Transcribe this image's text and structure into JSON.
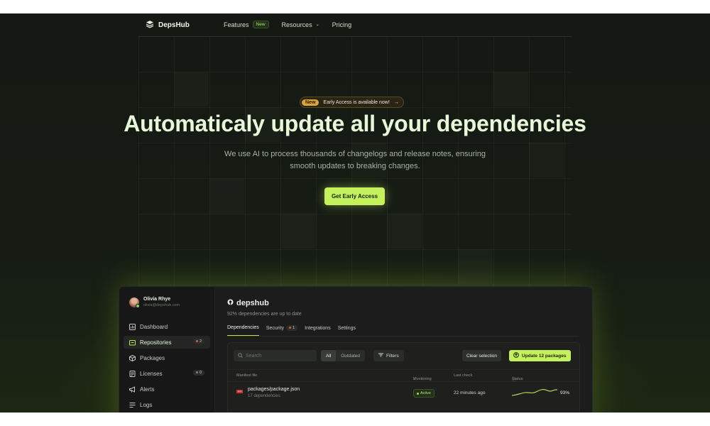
{
  "nav": {
    "brand": "DepsHub",
    "links": [
      {
        "label": "Features",
        "badge": "New"
      },
      {
        "label": "Resources"
      },
      {
        "label": "Pricing"
      }
    ]
  },
  "hero": {
    "eyebrow_tag": "New",
    "eyebrow_text": "Early Access is available now!",
    "title": "Automaticaly update all your dependencies",
    "subtitle_line1": "We use AI to process thousands of changelogs and release notes, ensuring",
    "subtitle_line2": "smooth updates to breaking changes.",
    "cta": "Get Early Access"
  },
  "app": {
    "user": {
      "name": "Olivia Rhye",
      "email": "olivia@depshub.com"
    },
    "sidebar": [
      {
        "label": "Dashboard",
        "icon": "chart-bar-icon"
      },
      {
        "label": "Repositories",
        "icon": "folder-icon",
        "badge": "2",
        "badge_color": "#e0544e"
      },
      {
        "label": "Packages",
        "icon": "package-icon"
      },
      {
        "label": "Licenses",
        "icon": "document-icon",
        "badge": "0",
        "badge_color": "#7e8579"
      },
      {
        "label": "Alerts",
        "icon": "megaphone-icon"
      },
      {
        "label": "Logs",
        "icon": "lines-icon"
      }
    ],
    "repo": {
      "name": "depshub",
      "status": "92% dependencies are up to date"
    },
    "tabs": [
      {
        "label": "Dependencies"
      },
      {
        "label": "Security",
        "badge": "1"
      },
      {
        "label": "Integrations"
      },
      {
        "label": "Settings"
      }
    ],
    "toolbar": {
      "search_placeholder": "Search",
      "segments": [
        "All",
        "Outdated"
      ],
      "filters": "Filters",
      "clear": "Clear selection",
      "update": "Update 12 packages"
    },
    "table": {
      "columns": [
        "Manifest file",
        "Monitoring",
        "Last check",
        "Status"
      ],
      "rows": [
        {
          "file_type": "npm",
          "file": "packages/package.json",
          "deps": "17 dependencies",
          "monitoring": "Active",
          "last_check": "22 minutes ago",
          "status_pct": "93%"
        }
      ]
    }
  },
  "colors": {
    "accent": "#c3f25c",
    "background": "#141a13"
  }
}
